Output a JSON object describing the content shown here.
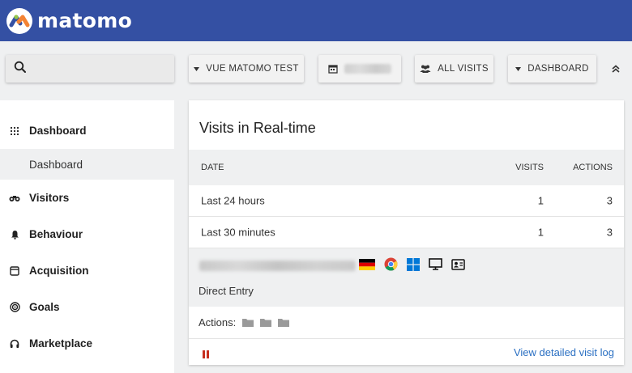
{
  "brand": {
    "name": "matomo",
    "header_color": "#3450a3"
  },
  "toolbar": {
    "search_icon": "search-icon",
    "site_selector": "VUE MATOMO TEST",
    "date_icon": "calendar-icon",
    "segment": "ALL VISITS",
    "dashboard": "DASHBOARD",
    "collapse_icon": "chevron-double-up-icon"
  },
  "sidebar": {
    "items": [
      {
        "label": "Dashboard",
        "icon": "grid-icon"
      },
      {
        "label": "Visitors",
        "icon": "binoculars-icon"
      },
      {
        "label": "Behaviour",
        "icon": "bell-icon"
      },
      {
        "label": "Acquisition",
        "icon": "window-icon"
      },
      {
        "label": "Goals",
        "icon": "target-icon"
      },
      {
        "label": "Marketplace",
        "icon": "headset-icon"
      }
    ],
    "sub_item": "Dashboard"
  },
  "widget": {
    "title": "Visits in Real-time",
    "columns": {
      "date": "DATE",
      "visits": "VISITS",
      "actions": "ACTIONS"
    },
    "rows": [
      {
        "date": "Last 24 hours",
        "visits": "1",
        "actions": "3"
      },
      {
        "date": "Last 30 minutes",
        "visits": "1",
        "actions": "3"
      }
    ],
    "visit": {
      "icons": [
        "germany-flag-icon",
        "chrome-icon",
        "windows-icon",
        "desktop-icon",
        "contact-card-icon"
      ],
      "referrer": "Direct Entry",
      "actions_label": "Actions:",
      "action_icons": [
        "folder-icon",
        "folder-icon",
        "folder-icon"
      ]
    },
    "footer": {
      "pause_icon": "pause-icon",
      "link": "View detailed visit log",
      "pause_color": "#c62f1f",
      "link_color": "#2a6fc2"
    }
  }
}
